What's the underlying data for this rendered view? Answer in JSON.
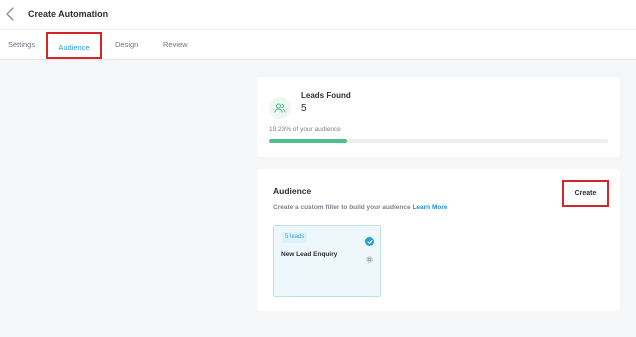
{
  "header": {
    "title": "Create Automation",
    "back_icon": "chevron-left-icon"
  },
  "tabs": [
    {
      "label": "Settings",
      "active": false
    },
    {
      "label": "Audience",
      "active": true
    },
    {
      "label": "Design",
      "active": false
    },
    {
      "label": "Review",
      "active": false
    }
  ],
  "leads": {
    "title": "Leads Found",
    "count": "5",
    "percent_text": "19.23% of your audience",
    "progress_fraction": 0.23,
    "icon": "users-icon"
  },
  "audience": {
    "title": "Audience",
    "subtitle": "Create a custom filter to build your audience",
    "learn_more": "Learn More",
    "create_label": "Create",
    "segment": {
      "badge": "5 leads",
      "name": "New Lead Enquiry",
      "selected": true
    }
  },
  "colors": {
    "accent": "#2a9fd6",
    "progress": "#4fc08d",
    "highlight_box": "#d3262b"
  }
}
